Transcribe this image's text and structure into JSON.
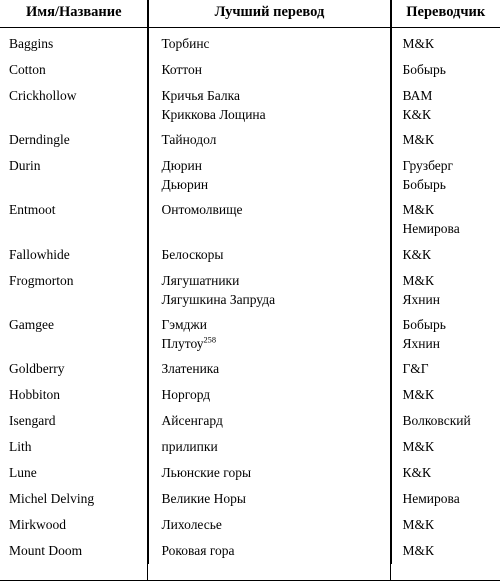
{
  "table": {
    "headers": {
      "name": "Имя/Название",
      "translation": "Лучший перевод",
      "translator": "Переводчик"
    },
    "rows": [
      {
        "name": "Baggins",
        "translation": [
          "Торбинс"
        ],
        "translator": [
          "М&К"
        ]
      },
      {
        "name": "Cotton",
        "translation": [
          "Коттон"
        ],
        "translator": [
          "Бобырь"
        ]
      },
      {
        "name": "Crickhollow",
        "translation": [
          "Кричья Балка",
          "Криккова Лощина"
        ],
        "translator": [
          "ВАМ",
          "К&К"
        ]
      },
      {
        "name": "Derndingle",
        "translation": [
          "Тайнодол"
        ],
        "translator": [
          "М&К"
        ]
      },
      {
        "name": "Durin",
        "translation": [
          "Дюрин",
          "Дьюрин"
        ],
        "translator": [
          "Грузберг",
          "Бобырь"
        ]
      },
      {
        "name": "Entmoot",
        "translation": [
          "Онтомолвище"
        ],
        "translator": [
          "М&К",
          "Немирова"
        ]
      },
      {
        "name": "Fallowhide",
        "translation": [
          "Белоскоры"
        ],
        "translator": [
          "К&К"
        ]
      },
      {
        "name": "Frogmorton",
        "translation": [
          "Лягушатники",
          "Лягушкина Запруда"
        ],
        "translator": [
          "М&К",
          "Яхнин"
        ]
      },
      {
        "name": "Gamgee",
        "translation": [
          "Гэмджи",
          "Плутоу"
        ],
        "translation_sup": [
          null,
          "258"
        ],
        "translator": [
          "Бобырь",
          "Яхнин"
        ]
      },
      {
        "name": "Goldberry",
        "translation": [
          "Златеника"
        ],
        "translator": [
          "Г&Г"
        ]
      },
      {
        "name": "Hobbiton",
        "translation": [
          "Норгорд"
        ],
        "translator": [
          "М&К"
        ]
      },
      {
        "name": "Isengard",
        "translation": [
          "Айсенгард"
        ],
        "translator": [
          "Волковский"
        ]
      },
      {
        "name": "Lith",
        "translation": [
          "прилипки"
        ],
        "translator": [
          "М&К"
        ]
      },
      {
        "name": "Lune",
        "translation": [
          "Льюнские горы"
        ],
        "translator": [
          "К&К"
        ]
      },
      {
        "name": "Michel Delving",
        "translation": [
          "Великие Норы"
        ],
        "translator": [
          "Немирова"
        ]
      },
      {
        "name": "Mirkwood",
        "translation": [
          "Лихолесье"
        ],
        "translator": [
          "М&К"
        ]
      },
      {
        "name": "Mount Doom",
        "translation": [
          "Роковая гора"
        ],
        "translator": [
          "М&К"
        ]
      }
    ]
  }
}
